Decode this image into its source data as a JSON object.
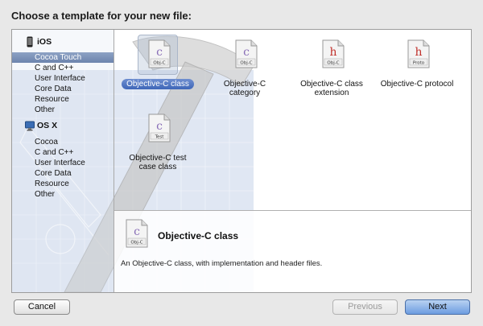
{
  "dialog": {
    "title": "Choose a template for your new file:"
  },
  "sidebar": {
    "sections": [
      {
        "header": "iOS",
        "icon": "iphone-icon",
        "items": [
          "Cocoa Touch",
          "C and C++",
          "User Interface",
          "Core Data",
          "Resource",
          "Other"
        ]
      },
      {
        "header": "OS X",
        "icon": "mac-icon",
        "items": [
          "Cocoa",
          "C and C++",
          "User Interface",
          "Core Data",
          "Resource",
          "Other"
        ]
      }
    ],
    "selected": "Cocoa Touch"
  },
  "templates": [
    {
      "label": "Objective-C class",
      "badge": "Obj-C",
      "glyph": "c",
      "selected": true
    },
    {
      "label": "Objective-C category",
      "badge": "Obj-C",
      "glyph": "c",
      "selected": false
    },
    {
      "label": "Objective-C class extension",
      "badge": "Obj-C",
      "glyph": "h",
      "selected": false
    },
    {
      "label": "Objective-C protocol",
      "badge": "Proto",
      "glyph": "h",
      "selected": false
    },
    {
      "label": "Objective-C test case class",
      "badge": "Test",
      "glyph": "c",
      "selected": false
    }
  ],
  "detail": {
    "title": "Objective-C class",
    "badge": "Obj-C",
    "description": "An Objective-C class, with implementation and header files."
  },
  "buttons": {
    "cancel": "Cancel",
    "previous": "Previous",
    "next": "Next"
  },
  "colors": {
    "selection": "#3e66b8",
    "sidebar_selection": "#7a8fb5",
    "blueprint": "#9fb4d8"
  }
}
